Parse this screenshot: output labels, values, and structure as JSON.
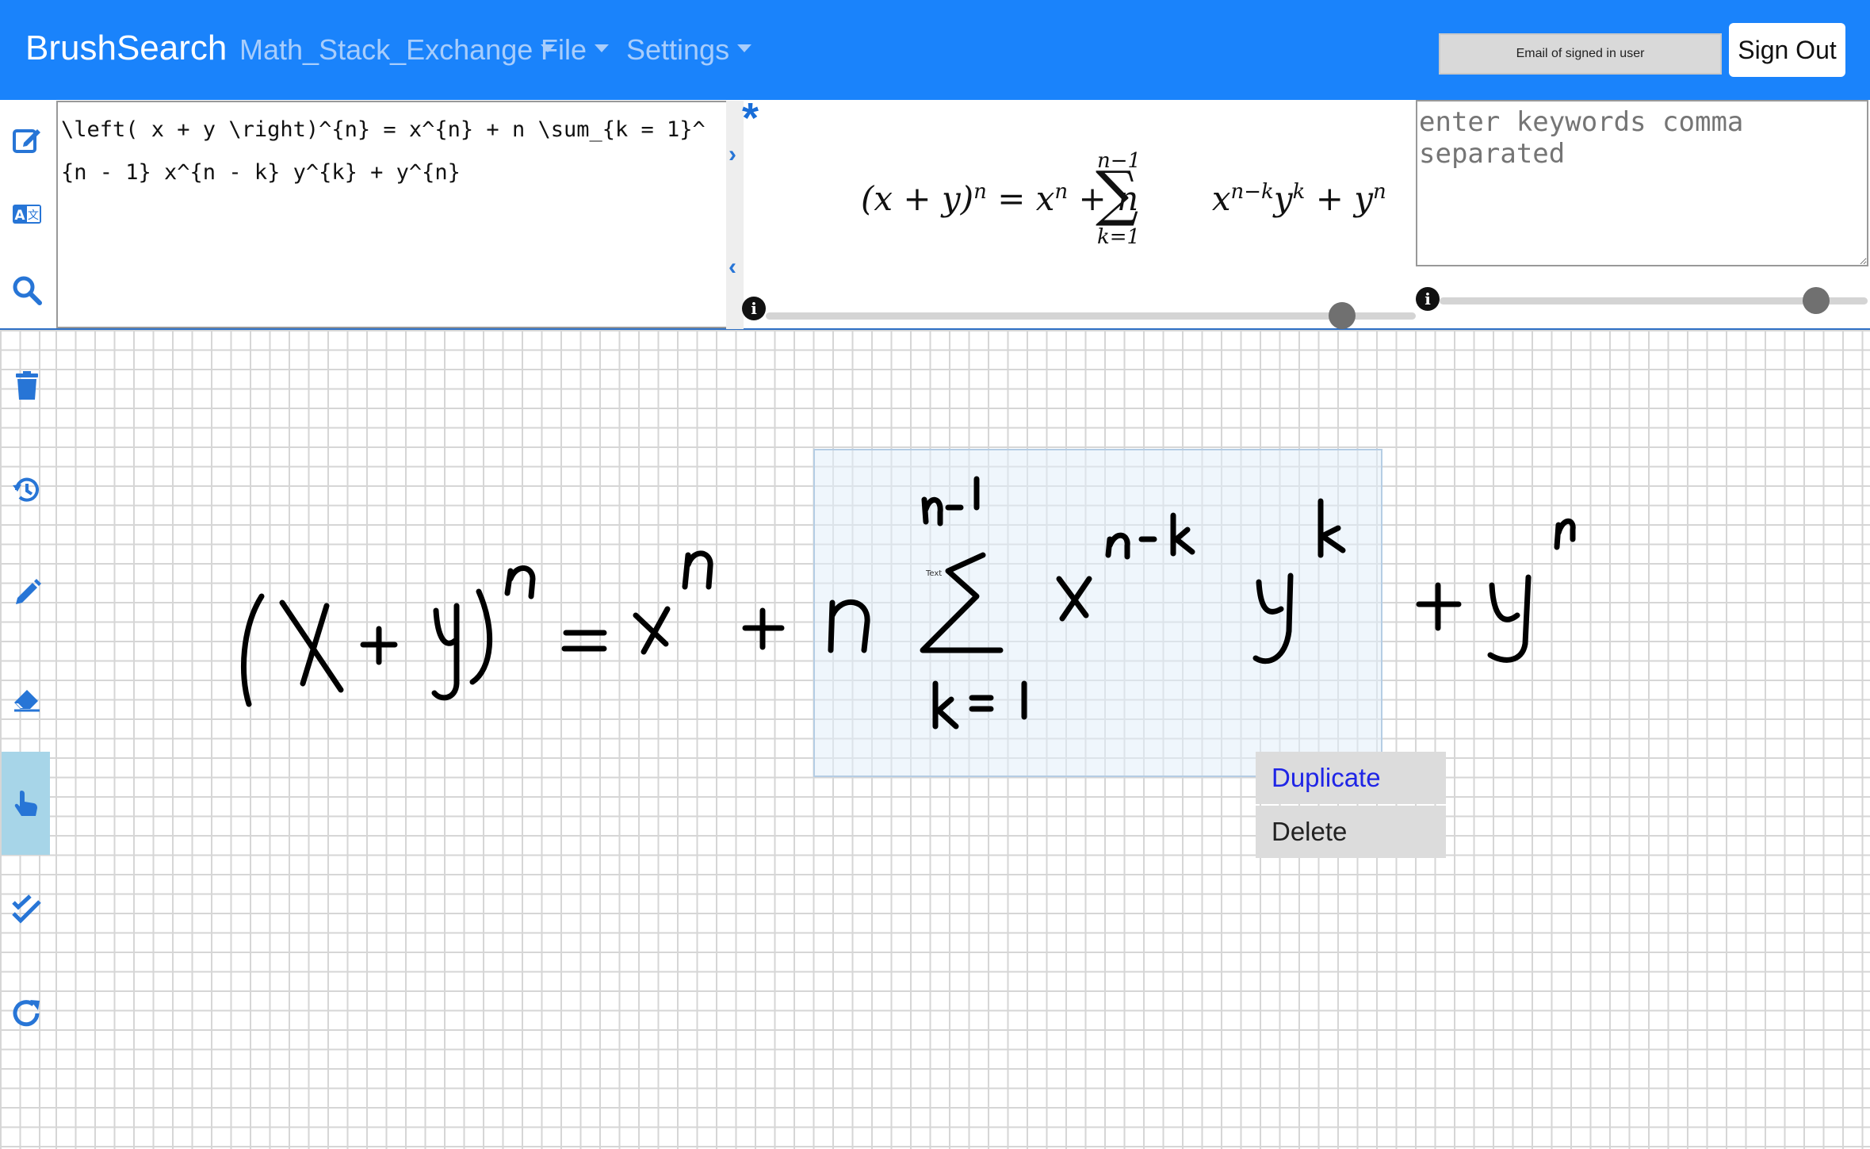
{
  "navbar": {
    "brand": "BrushSearch",
    "menus": [
      {
        "label": "Math_Stack_Exchange"
      },
      {
        "label": "File"
      },
      {
        "label": "Settings"
      }
    ],
    "user_email": "Email of signed in user",
    "sign_out": "Sign Out"
  },
  "left_toolbar": {
    "top_icons": [
      "edit-icon",
      "translate-icon",
      "search-icon"
    ],
    "canvas_icons": [
      "trash-icon",
      "history-icon",
      "pencil-icon",
      "eraser-icon",
      "hand-pointer-icon",
      "check-double-icon",
      "redo-icon"
    ],
    "active_tool": "hand-pointer-icon"
  },
  "latex_editor": {
    "value": "\\left( x + y \\right)^{n} = x^{n} + n \\sum_{k = 1}^{n - 1} x^{n - k} y^{k} + y^{n}"
  },
  "preview": {
    "lhs": "(x + y)",
    "lhs_exp": "n",
    "eq_part": "= x",
    "x_exp": "n",
    "plus_n": "+ n",
    "sum_upper": "n−1",
    "sum_symbol": "∑",
    "sum_lower": "k=1",
    "term_x": "x",
    "term_x_exp": "n−k",
    "term_y": "y",
    "term_y_exp": "k",
    "tail": "+ y",
    "tail_exp": "n",
    "star": "*",
    "slider_value": 0.89
  },
  "keywords": {
    "placeholder": "enter keywords comma separated",
    "slider_value": 0.9
  },
  "canvas": {
    "context_menu": {
      "duplicate": "Duplicate",
      "delete": "Delete"
    },
    "tiny_label": "Text"
  },
  "colors": {
    "navbar": "#1a83fb",
    "accent": "#2775d6",
    "menu_duplicate": "#1f25e6"
  }
}
